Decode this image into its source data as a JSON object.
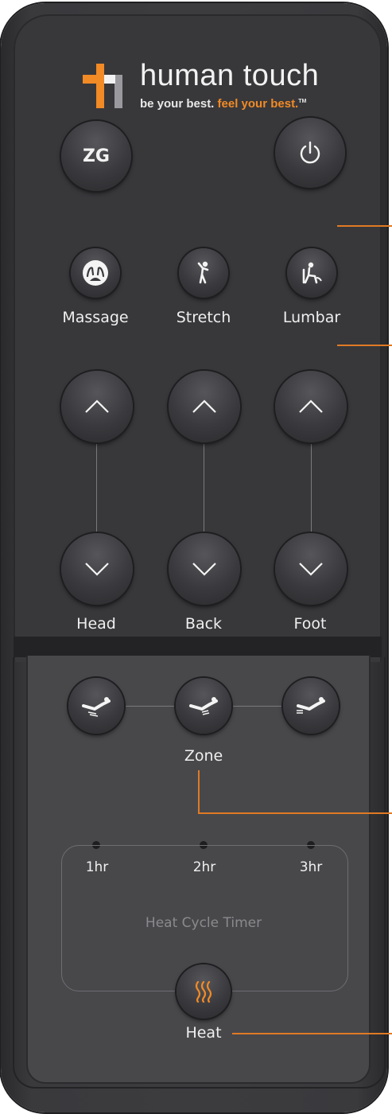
{
  "brand": {
    "name": "human touch",
    "tagline_prefix": "be your best.",
    "tagline_accent": "feel your best.",
    "trademark": "TM",
    "accent_color": "#f28a25"
  },
  "top_buttons": {
    "zg_label": "ZG",
    "power_icon": "power-icon"
  },
  "programs": [
    {
      "label": "Massage",
      "icon": "massage-hands-icon"
    },
    {
      "label": "Stretch",
      "icon": "stretch-person-icon"
    },
    {
      "label": "Lumbar",
      "icon": "lumbar-seated-icon"
    }
  ],
  "positions": [
    {
      "label": "Head"
    },
    {
      "label": "Back"
    },
    {
      "label": "Foot"
    }
  ],
  "zone": {
    "label": "Zone",
    "buttons": [
      "upper-zone-icon",
      "middle-zone-icon",
      "lower-zone-icon"
    ]
  },
  "timer": {
    "title": "Heat Cycle Timer",
    "options": [
      "1hr",
      "2hr",
      "3hr"
    ]
  },
  "heat": {
    "label": "Heat",
    "icon": "heat-waves-icon"
  }
}
